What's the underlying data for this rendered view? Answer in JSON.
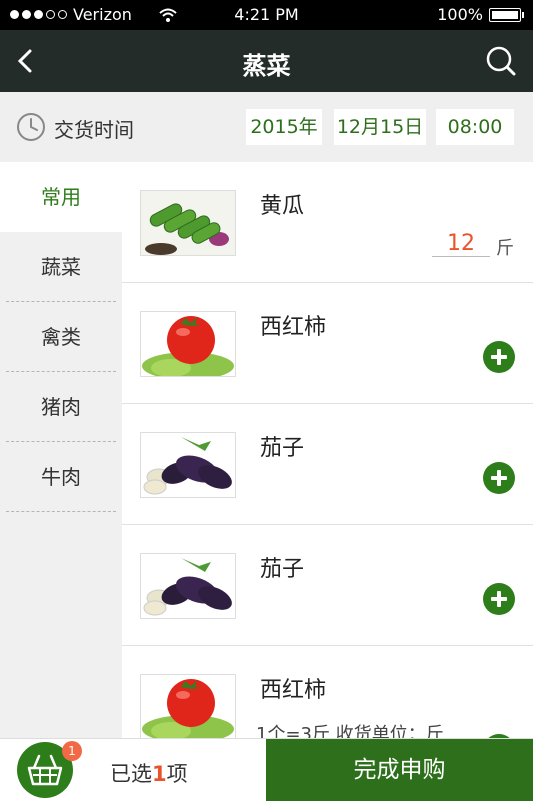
{
  "status": {
    "carrier": "Verizon",
    "time": "4:21 PM",
    "battery": "100%"
  },
  "nav": {
    "title": "蒸菜"
  },
  "delivery": {
    "label": "交货时间",
    "year": "2015年",
    "date": "12月15日",
    "time": "08:00"
  },
  "categories": [
    {
      "label": "常用",
      "active": true
    },
    {
      "label": "蔬菜"
    },
    {
      "label": "禽类"
    },
    {
      "label": "猪肉"
    },
    {
      "label": "牛肉"
    }
  ],
  "items": [
    {
      "name": "黄瓜",
      "quantity": "12",
      "unit": "斤",
      "image": "cucumber"
    },
    {
      "name": "西红柿",
      "image": "tomato"
    },
    {
      "name": "茄子",
      "image": "eggplant"
    },
    {
      "name": "茄子",
      "image": "eggplant"
    },
    {
      "name": "西红柿",
      "meta": "1个=3斤  收货单位：斤",
      "image": "tomato"
    }
  ],
  "cart": {
    "badge": "1",
    "selected_prefix": "已选",
    "selected_count": "1",
    "selected_suffix": "项"
  },
  "footer": {
    "complete_label": "完成申购"
  },
  "colors": {
    "accent": "#2e6f1c",
    "highlight": "#e8542c",
    "navbar": "#242c29"
  }
}
